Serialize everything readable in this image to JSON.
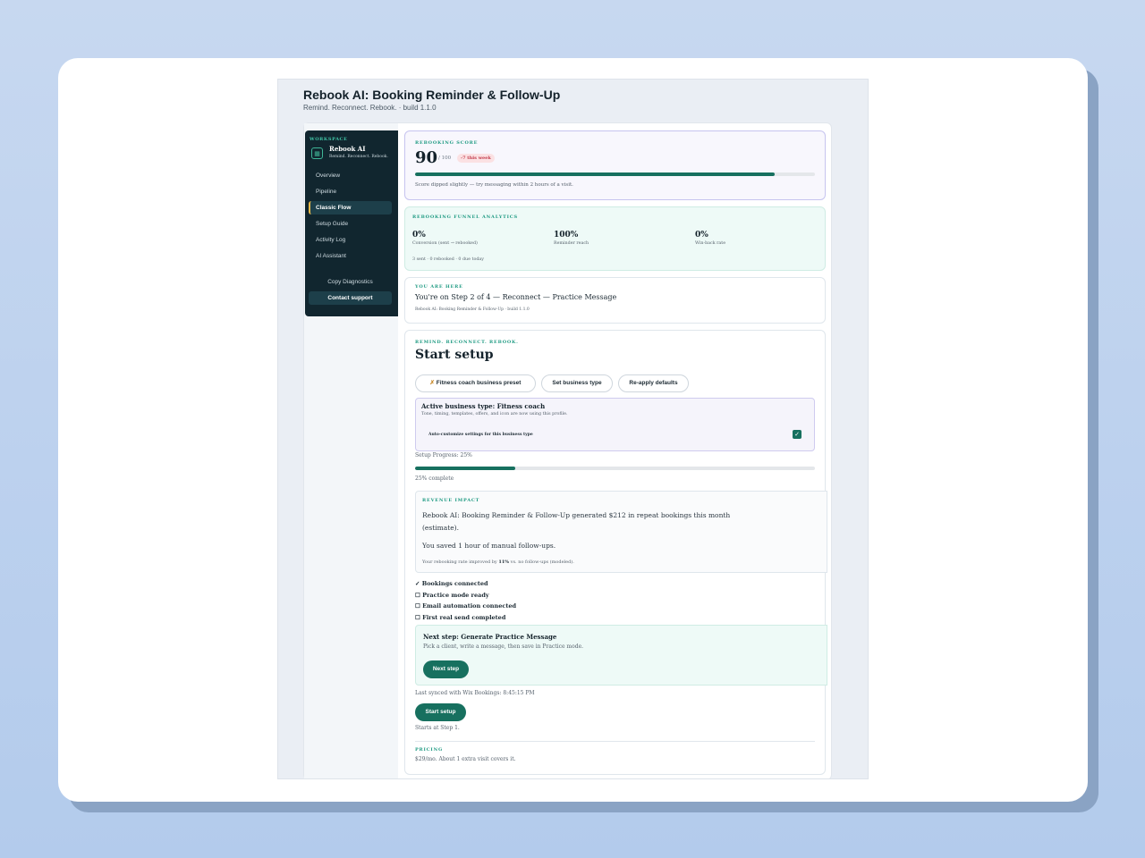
{
  "app": {
    "title": "Rebook AI: Booking Reminder & Follow-Up",
    "subtitle": "Remind. Reconnect. Rebook. · build 1.1.0"
  },
  "sidebar": {
    "workspace_label": "WORKSPACE",
    "name": "Rebook AI",
    "tagline": "Remind. Reconnect. Rebook.",
    "items": [
      {
        "label": "Overview",
        "active": false
      },
      {
        "label": "Pipeline",
        "active": false
      },
      {
        "label": "Classic Flow",
        "active": true
      },
      {
        "label": "Setup Guide",
        "active": false
      },
      {
        "label": "Activity Log",
        "active": false
      },
      {
        "label": "AI Assistant",
        "active": false
      }
    ],
    "copy_diagnostics": "Copy Diagnostics",
    "contact_support": "Contact support"
  },
  "score": {
    "label": "REBOOKING SCORE",
    "value": "90",
    "max": "/ 100",
    "badge": "-7 this week",
    "progress_percent": 90,
    "note": "Score dipped slightly — try messaging within 2 hours of a visit."
  },
  "funnel": {
    "label": "REBOOKING FUNNEL ANALYTICS",
    "metrics": [
      {
        "value": "0%",
        "label": "Conversion (sent → rebooked)"
      },
      {
        "value": "100%",
        "label": "Reminder reach"
      },
      {
        "value": "0%",
        "label": "Win-back rate"
      }
    ],
    "footer": "3 sent · 0 rebooked · 0 due today"
  },
  "here": {
    "label": "YOU ARE HERE",
    "title": "You're on Step 2 of 4 — Reconnect — Practice Message",
    "sub": "Rebook AI: Booking Reminder & Follow-Up · build 1.1.0"
  },
  "setup": {
    "eyebrow": "REMIND. RECONNECT. REBOOK.",
    "title": "Start setup",
    "buttons": {
      "preset": "Fitness coach business preset",
      "set_type": "Set business type",
      "reapply": "Re-apply defaults"
    },
    "business": {
      "title": "Active business type: Fitness coach",
      "sub": "Tone, timing, templates, offers, and icon are now using this profile.",
      "auto_label": "Auto-customize settings for this business type",
      "auto_checked": true
    },
    "progress_label": "Setup Progress: 25%",
    "progress_percent": 25,
    "progress_complete": "25% complete",
    "revenue": {
      "label": "REVENUE IMPACT",
      "line1": "Rebook AI: Booking Reminder & Follow-Up generated $212 in repeat bookings this month",
      "line1b": "(estimate).",
      "line2": "You saved 1 hour of manual follow-ups.",
      "line3_pre": "Your rebooking rate improved by ",
      "line3_bold": "11%",
      "line3_post": " vs. no follow-ups (modeled)."
    },
    "checklist": [
      "✓ Bookings connected",
      "☐ Practice mode ready",
      "☐ Email automation connected",
      "☐ First real send completed"
    ],
    "next": {
      "title": "Next step: Generate Practice Message",
      "sub": "Pick a client, write a message, then save in Practice mode.",
      "button": "Next step"
    },
    "synced": "Last synced with Wix Bookings: 8:45:15 PM",
    "start_button": "Start setup",
    "starts_at": "Starts at Step 1.",
    "pricing_label": "PRICING",
    "pricing_text": "$29/mo. About 1 extra visit covers it."
  }
}
